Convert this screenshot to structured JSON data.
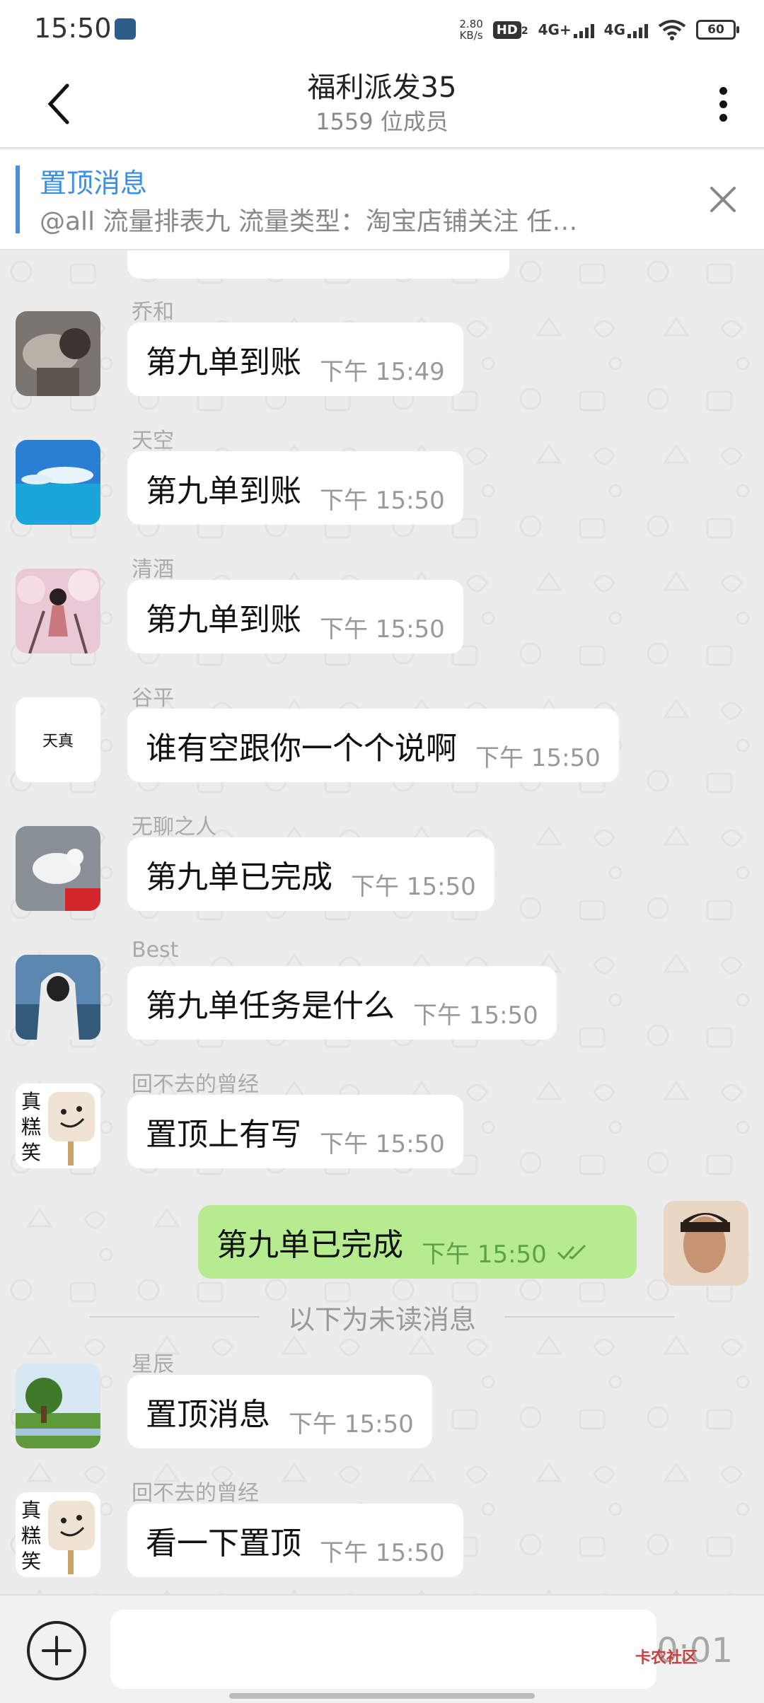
{
  "status_bar": {
    "time": "15:50",
    "net_speed": "2.80",
    "net_unit": "KB/s",
    "hd_label": "HD",
    "hd_sub": "2",
    "net1": "4G+",
    "net2": "4G",
    "battery": "60"
  },
  "header": {
    "title": "福利派发35",
    "subtitle": "1559 位成员"
  },
  "pinned": {
    "title": "置顶消息",
    "text": "@all 流量排表九 流量类型：淘宝店铺关注 任…"
  },
  "messages": [
    {
      "sender": "乔和",
      "text": "第九单到账",
      "time": "下午  15:49",
      "avatar": "photo-couple"
    },
    {
      "sender": "天空",
      "text": "第九单到账",
      "time": "下午  15:50",
      "avatar": "photo-sea"
    },
    {
      "sender": "清酒",
      "text": "第九单到账",
      "time": "下午  15:50",
      "avatar": "photo-blossom"
    },
    {
      "sender": "谷平",
      "text": "谁有空跟你一个个说啊",
      "time": "下午  15:50",
      "avatar_text": "天真"
    },
    {
      "sender": "无聊之人",
      "text": "第九单已完成",
      "time": "下午  15:50",
      "avatar": "photo-dove"
    },
    {
      "sender": "Best",
      "text": "第九单任务是什么",
      "time": "下午  15:50",
      "avatar": "photo-hoodie"
    },
    {
      "sender": "回不去的曾经",
      "text": "置顶上有写",
      "time": "下午  15:50",
      "avatar_text_vertical": [
        "真",
        "糕",
        "笑"
      ]
    },
    {
      "sender": "星辰",
      "text": "置顶消息",
      "time": "下午  15:50",
      "avatar": "photo-landscape"
    },
    {
      "sender": "回不去的曾经",
      "text": "看一下置顶",
      "time": "下午  15:50",
      "avatar_text_vertical": [
        "真",
        "糕",
        "笑"
      ]
    }
  ],
  "my_message": {
    "text": "第九单已完成",
    "time": "下午  15:50",
    "status_icon": "double-check-icon"
  },
  "unread_divider": "以下为未读消息",
  "input_bar": {
    "placeholder": "",
    "record_time": "0:01",
    "watermark": "卡农社区"
  },
  "colors": {
    "accent": "#3a8ee6",
    "my_bubble": "#b7eb8f",
    "chat_bg": "#ececec"
  }
}
